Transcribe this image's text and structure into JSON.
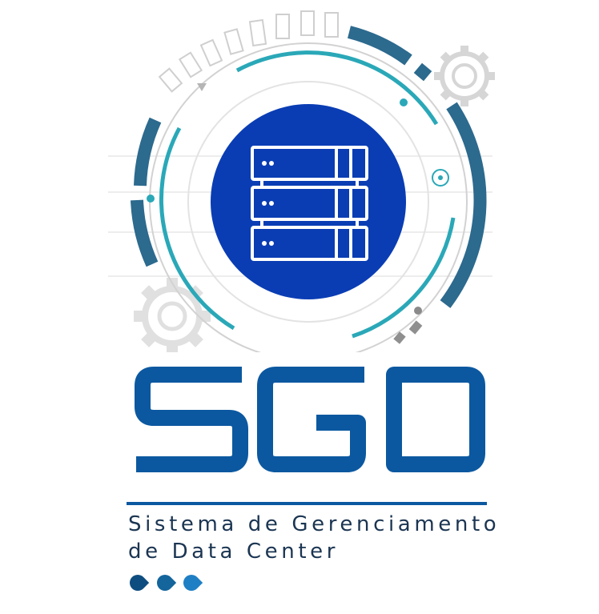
{
  "logo": {
    "wordmark": "SGD",
    "tagline_line1": "Sistema de Gerenciamento",
    "tagline_line2": "de Data Center"
  },
  "colors": {
    "primary_blue": "#0b58a0",
    "disc_blue": "#0a3db4",
    "teal": "#2aa8b8",
    "steel": "#2c6a8e",
    "light_gray": "#cfcfcf",
    "text_dark": "#1b3552",
    "dot_1": "#0e4d80",
    "dot_2": "#13659c",
    "dot_3": "#1f7fc4"
  },
  "icons": [
    "server-rack-icon",
    "gear-icon"
  ]
}
